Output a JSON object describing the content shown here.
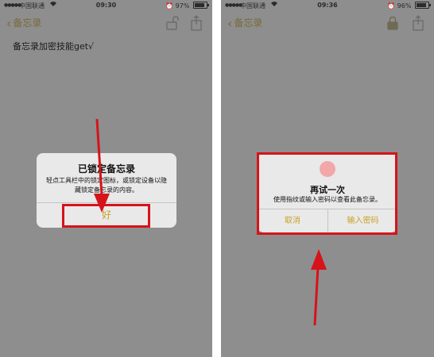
{
  "left_screen": {
    "status": {
      "carrier": "中国联通",
      "time": "09:30",
      "battery": "97%"
    },
    "nav": {
      "back_label": "备忘录"
    },
    "note_title": "备忘录加密技能get√",
    "alert": {
      "title": "已锁定备忘录",
      "message": "轻点工具栏中的锁定图标，或锁定设备以隐藏锁定备忘录的内容。",
      "ok_label": "好"
    }
  },
  "right_screen": {
    "status": {
      "carrier": "中国联通",
      "time": "09:36",
      "battery": "96%"
    },
    "nav": {
      "back_label": "备忘录"
    },
    "alert": {
      "title": "再试一次",
      "message": "使用指纹或输入密码以查看此备忘录。",
      "cancel_label": "取消",
      "enter_password_label": "输入密码"
    }
  },
  "colors": {
    "accent": "#c9a227",
    "annotation_red": "#d6131b",
    "backdrop": "#8e8e8e",
    "alert_bg": "#e9e9e9"
  }
}
